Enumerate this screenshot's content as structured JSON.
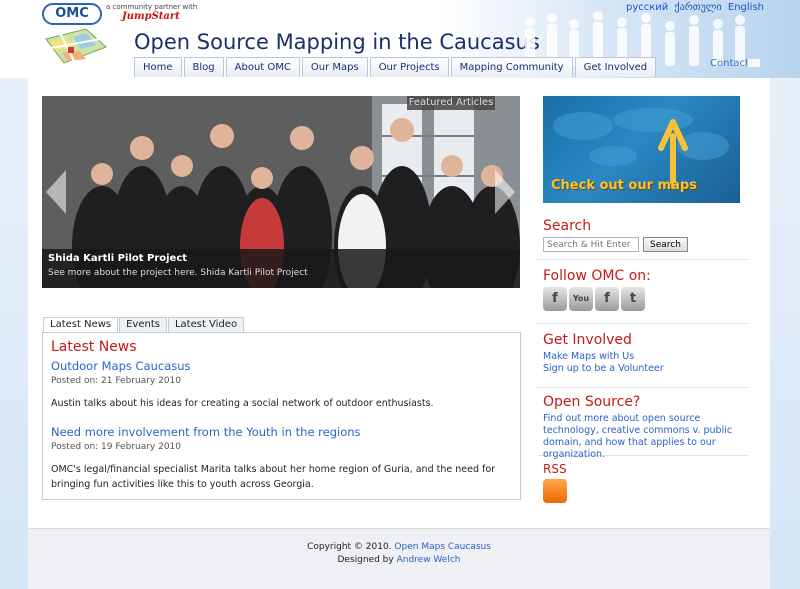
{
  "header": {
    "logo_text": "OMC",
    "partner_line": "a community partner with",
    "partner_name": "JumpStart",
    "site_title": "Open Source Mapping in the Caucasus",
    "languages": [
      "русский",
      "ქართული",
      "English"
    ],
    "contact_label": "Contact"
  },
  "nav": {
    "items": [
      "Home",
      "Blog",
      "About OMC",
      "Our Maps",
      "Our Projects",
      "Mapping Community",
      "Get Involved"
    ]
  },
  "slider": {
    "featured_label": "Featured Articles",
    "caption_title": "Shida Kartli Pilot Project",
    "caption_text": "See more about the project here. Shida Kartli Pilot Project"
  },
  "tabs": [
    "Latest News",
    "Events",
    "Latest Video"
  ],
  "news": {
    "heading": "Latest News",
    "items": [
      {
        "title": "Outdoor Maps Caucasus",
        "date": "Posted on: 21 February 2010",
        "body": "Austin talks about his ideas for creating a social network of outdoor enthusiasts."
      },
      {
        "title": "Need more involvement from the Youth in the regions",
        "date": "Posted on: 19 February 2010",
        "body": "OMC's legal/financial specialist Marita talks about her home region of Guria, and the need for bringing fun activities like this to youth across Georgia."
      }
    ]
  },
  "sidebar": {
    "promo_text": "Check out our maps",
    "search": {
      "heading": "Search",
      "placeholder": "Search & Hit Enter",
      "button": "Search"
    },
    "follow": {
      "heading": "Follow OMC on:",
      "icons": [
        "f",
        "You",
        "f",
        "t"
      ]
    },
    "involved": {
      "heading": "Get Involved",
      "links": [
        "Make Maps with Us",
        "Sign up to be a Volunteer"
      ]
    },
    "open_source": {
      "heading": "Open Source?",
      "text": "Find out more about open source technology, creative commons v. public domain, and how that applies to our organization."
    },
    "rss": {
      "heading": "RSS"
    }
  },
  "footer": {
    "copyright": "Copyright © 2010.",
    "copyright_link": "Open Maps Caucasus",
    "designed_by": "Designed by",
    "designer": "Andrew Welch"
  },
  "colors": {
    "heading_red": "#c31a1a",
    "link_blue": "#2a63c8",
    "title_navy": "#1a2f6b",
    "promo_gold": "#f6c23a"
  }
}
